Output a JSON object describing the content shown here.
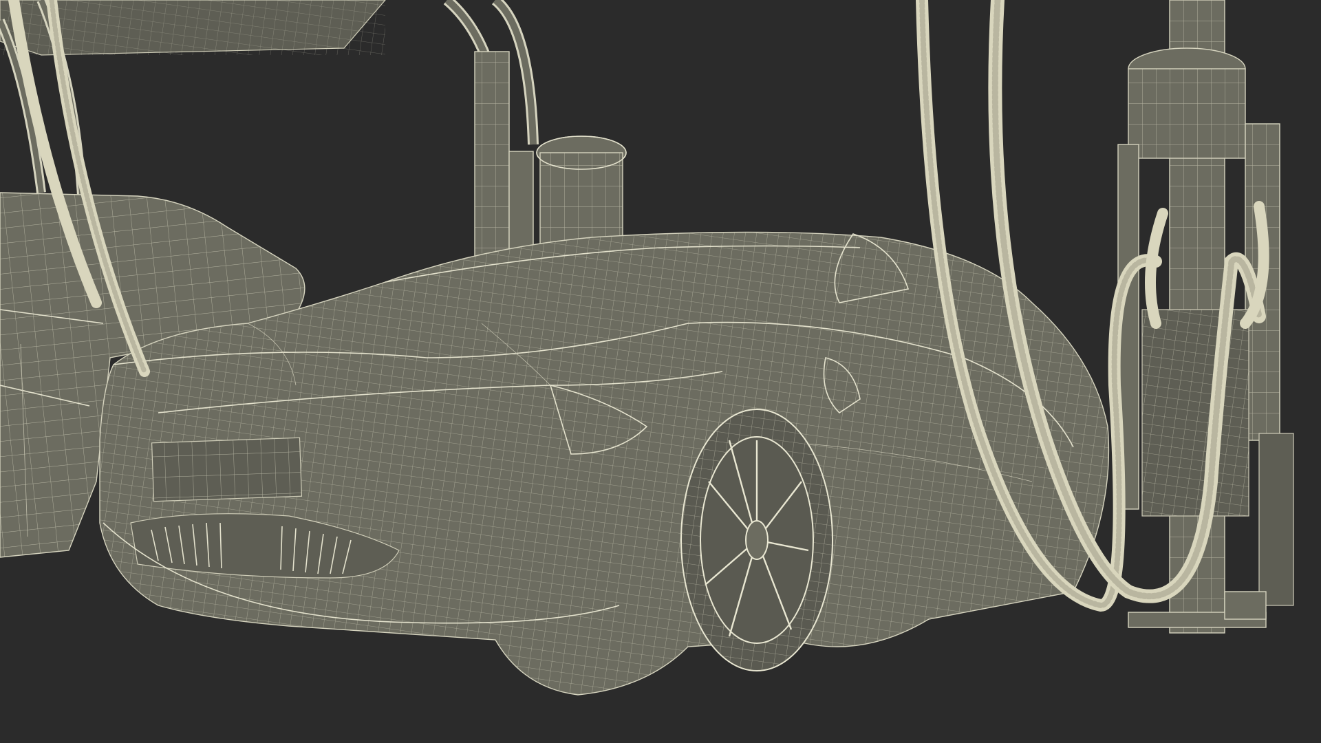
{
  "scene": {
    "background_color": "#2b2b2b",
    "mesh_fill_color": "#6c6c60",
    "wire_color": "#d6d4bf",
    "hose_color": "#d9d6bd",
    "subjects": [
      "sports-car",
      "second-car",
      "charging-station",
      "charging-hoses",
      "gantry-arches"
    ]
  }
}
